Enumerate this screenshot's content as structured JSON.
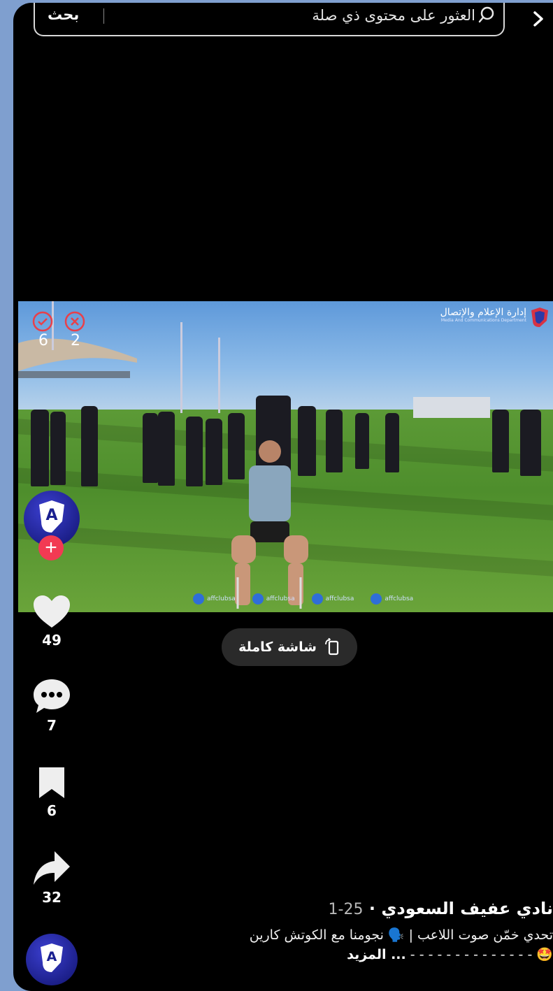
{
  "search": {
    "placeholder": "العثور على محتوى ذي صلة",
    "button_label": "بحث"
  },
  "video": {
    "media_title": "إدارة الإعلام والإتصال",
    "media_subtitle": "Media And Communications Department",
    "poll": {
      "check_count": "6",
      "cross_count": "2"
    },
    "social_handle": "affclubsa"
  },
  "actions": {
    "likes": "49",
    "comments": "7",
    "saves": "6",
    "shares": "32"
  },
  "fullscreen_label": "شاشة كاملة",
  "caption": {
    "author": "نادي عفيف السعودي",
    "separator": " · ",
    "date": "25-1",
    "text": "تحدي خمّن صوت اللاعب | 🗣️ نجومنا مع الكوتش كارين",
    "text_line2": "🤩 - - - - - - - - - - - - - -",
    "more_label": "... المزيد"
  },
  "colors": {
    "background": "#000000",
    "follow": "#f23a53",
    "frame": "#7f9fcf"
  },
  "icons": {
    "back": "chevron-right-icon",
    "search": "search-icon",
    "like": "heart-icon",
    "comment": "comment-icon",
    "save": "bookmark-icon",
    "share": "share-icon",
    "fullscreen": "rotate-screen-icon"
  }
}
